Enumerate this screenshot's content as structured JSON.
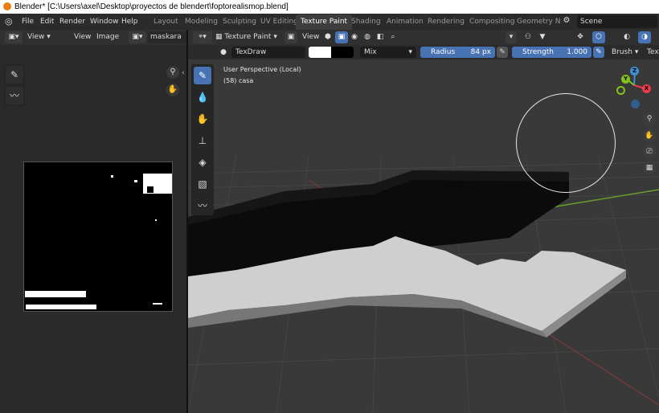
{
  "window": {
    "title": "Blender* [C:\\Users\\axel\\Desktop\\proyectos de blendert\\foptorealismop.blend]"
  },
  "menubar": {
    "menus": [
      "File",
      "Edit",
      "Render",
      "Window",
      "Help"
    ],
    "workspaces": [
      "Layout",
      "Modeling",
      "Sculpting",
      "UV Editing",
      "Texture Paint",
      "Shading",
      "Animation",
      "Rendering",
      "Compositing",
      "Geometry N"
    ],
    "active_workspace": "Texture Paint",
    "scene_label": "Scene"
  },
  "image_editor": {
    "header": {
      "view_label": "View",
      "view_menu": "View",
      "image_menu": "Image",
      "image_name": "maskara"
    },
    "tools": [
      {
        "name": "sample-tool",
        "icon": "eyedropper-icon"
      },
      {
        "name": "draw-tool",
        "icon": "brush-stroke-icon"
      }
    ]
  },
  "viewport": {
    "header": {
      "mode_label": "Texture Paint",
      "view_menu": "View"
    },
    "tool_settings": {
      "brush_name": "TexDraw",
      "blend_mode": "Mix",
      "radius_label": "Radius",
      "radius_value": "84 px",
      "strength_label": "Strength",
      "strength_value": "1.000",
      "brush_menu": "Brush",
      "trailing_menu": "Tex"
    },
    "overlay_info": {
      "view_name": "User Perspective (Local)",
      "object_info": "(58) casa"
    },
    "tools": [
      {
        "name": "draw",
        "icon": "brush-icon",
        "active": true
      },
      {
        "name": "soften",
        "icon": "drop-icon",
        "active": false
      },
      {
        "name": "smear",
        "icon": "smear-icon",
        "active": false
      },
      {
        "name": "clone",
        "icon": "stamp-icon",
        "active": false
      },
      {
        "name": "fill",
        "icon": "bucket-icon",
        "active": false
      },
      {
        "name": "mask",
        "icon": "mask-icon",
        "active": false
      },
      {
        "name": "annotate",
        "icon": "annotate-icon",
        "active": false
      }
    ],
    "gizmo": {
      "x_label": "X",
      "y_label": "Y",
      "z_label": "Z"
    },
    "colors": {
      "accent": "#4772b3",
      "x_axis": "#f03a4c",
      "y_axis": "#82c41b",
      "z_axis": "#3e8ed5",
      "grid_green": "#6a9d2d",
      "grid_red": "#a0393b"
    }
  }
}
